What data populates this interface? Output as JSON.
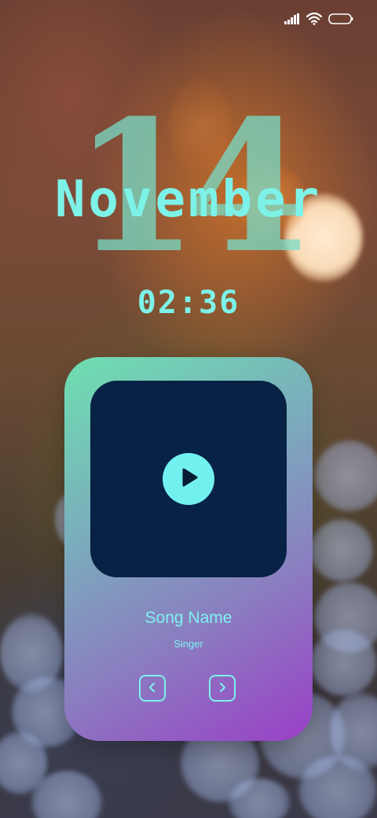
{
  "status_bar": {
    "icons": [
      "signal-icon",
      "wifi-icon",
      "battery-icon"
    ]
  },
  "lock_screen": {
    "day": "14",
    "month": "November",
    "time": "02:36"
  },
  "player": {
    "song_name": "Song Name",
    "singer": "Singer",
    "controls": [
      "play-icon",
      "chevron-left-icon",
      "chevron-right-icon"
    ]
  },
  "colors": {
    "accent": "#7df2e8",
    "art_background": "#072244",
    "card_gradient_start": "#6ee0b0",
    "card_gradient_end": "#9a3fc6"
  }
}
